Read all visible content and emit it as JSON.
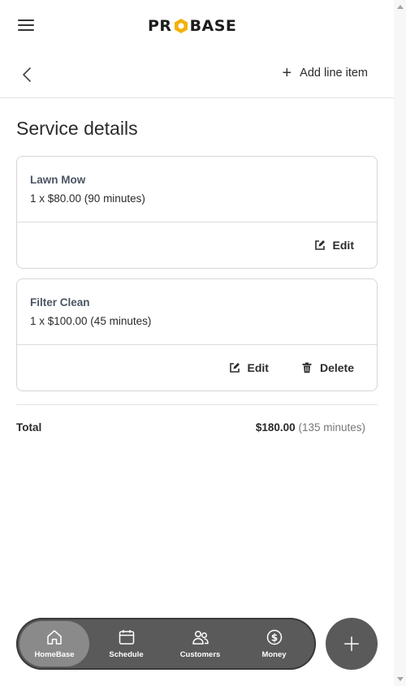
{
  "header": {
    "logo_text_left": "PR",
    "logo_text_right": "BASE",
    "brand_color": "#f5b10a"
  },
  "nav": {
    "add_line_label": "Add line item"
  },
  "page_title": "Service details",
  "line_items": [
    {
      "name": "Lawn Mow",
      "detail": "1 x $80.00 (90 minutes)",
      "edit_label": "Edit"
    },
    {
      "name": "Filter Clean",
      "detail": "1 x $100.00 (45 minutes)",
      "edit_label": "Edit",
      "delete_label": "Delete"
    }
  ],
  "total": {
    "label": "Total",
    "amount": "$180.00",
    "minutes": "(135 minutes)"
  },
  "bottom_nav": [
    {
      "label": "HomeBase",
      "icon": "home-icon",
      "active": true
    },
    {
      "label": "Schedule",
      "icon": "calendar-icon"
    },
    {
      "label": "Customers",
      "icon": "customers-icon"
    },
    {
      "label": "Money",
      "icon": "dollar-icon"
    }
  ],
  "fab_icon": "plus-icon"
}
